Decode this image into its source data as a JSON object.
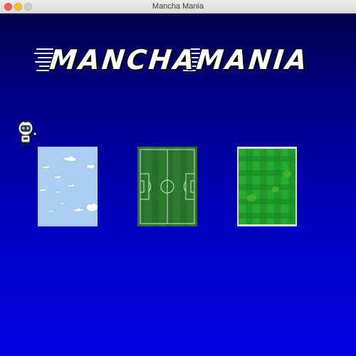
{
  "window": {
    "title": "Mancha Mania"
  },
  "game": {
    "logo_text": "MANCHAMANIA",
    "logo_color": "#ffffff",
    "background_top": "#00004a",
    "background_bottom": "#0000e0",
    "player": {
      "icon": "robot-icon"
    },
    "levels": [
      {
        "name": "sky",
        "icon": "sky-clouds-thumbnail"
      },
      {
        "name": "soccer-field",
        "icon": "soccer-field-thumbnail"
      },
      {
        "name": "grass",
        "icon": "grass-thumbnail"
      }
    ]
  }
}
